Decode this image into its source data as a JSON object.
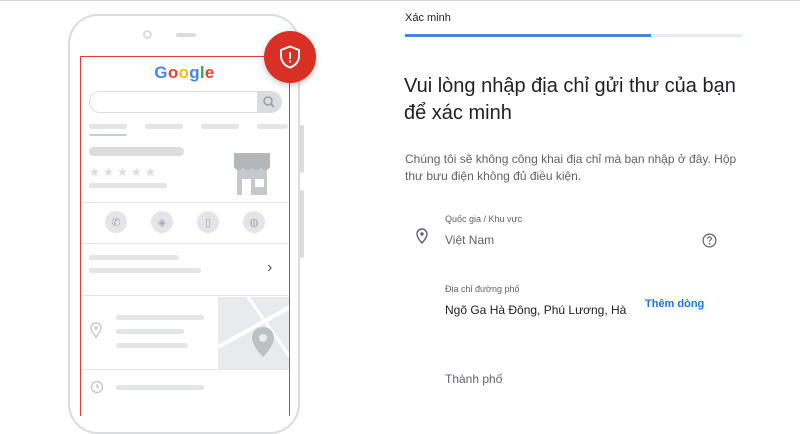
{
  "illustration": {
    "logo_letters": [
      {
        "char": "G",
        "color": "#4285F4"
      },
      {
        "char": "o",
        "color": "#EA4335"
      },
      {
        "char": "o",
        "color": "#FBBC05"
      },
      {
        "char": "g",
        "color": "#4285F4"
      },
      {
        "char": "l",
        "color": "#34A853"
      },
      {
        "char": "e",
        "color": "#EA4335"
      }
    ],
    "rating_stars": 5,
    "action_icons": [
      "phone-icon",
      "directions-icon",
      "bookmark-icon",
      "website-icon"
    ],
    "badge_icon": "shield-alert-icon",
    "badge_color": "#d93025"
  },
  "step": {
    "label": "Xác minh",
    "progress": 0.73,
    "track_color": "#e3ebf8",
    "fill_color": "#4a82d9"
  },
  "heading": "Vui lòng nhập địa chỉ gửi thư của bạn để xác minh",
  "description": "Chúng tôi sẽ không công khai địa chỉ mà bạn nhập ở đây. Hộp thư bưu điện không đủ điều kiện.",
  "form": {
    "country": {
      "label": "Quốc gia / Khu vực",
      "value": "Việt Nam",
      "icon": "location-pin-icon",
      "help_icon": "help-icon"
    },
    "street": {
      "label": "Địa chỉ đường phố",
      "value": "Ngõ Ga Hà Đông, Phú Lương, Hà"
    },
    "add_line_label": "Thêm dòng",
    "city": {
      "placeholder": "Thành phố"
    }
  }
}
